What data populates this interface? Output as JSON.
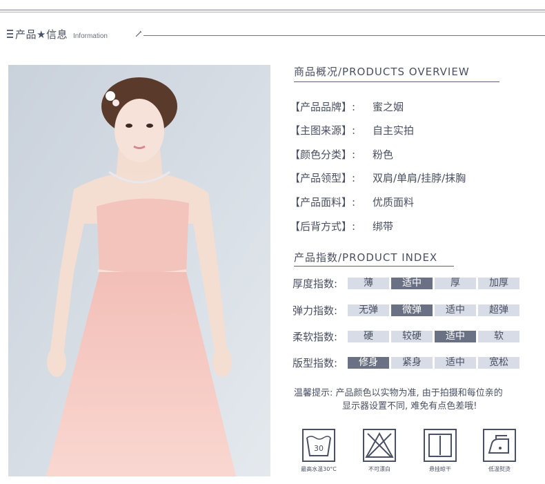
{
  "section_header": {
    "title": "产品★信息",
    "subtitle": "Information"
  },
  "overview": {
    "title": "商品概况/PRODUCTS OVERVIEW",
    "specs": [
      {
        "key": "【产品品牌】:",
        "value": "蜜之姻"
      },
      {
        "key": "【主图来源】:",
        "value": "自主实拍"
      },
      {
        "key": "【颜色分类】:",
        "value": "粉色"
      },
      {
        "key": "【产品领型】:",
        "value": "双肩/单肩/挂脖/抹胸"
      },
      {
        "key": "【产品面料】:",
        "value": "优质面料"
      },
      {
        "key": "【后背方式】:",
        "value": "绑带"
      }
    ]
  },
  "index": {
    "title": "产品指数/PRODUCT INDEX",
    "rows": [
      {
        "label": "厚度指数:",
        "options": [
          "薄",
          "适中",
          "厚",
          "加厚"
        ],
        "selected": 1
      },
      {
        "label": "弹力指数:",
        "options": [
          "无弹",
          "微弹",
          "适中",
          "超弹"
        ],
        "selected": 1
      },
      {
        "label": "柔软指数:",
        "options": [
          "硬",
          "较硬",
          "适中",
          "软"
        ],
        "selected": 2
      },
      {
        "label": "版型指数:",
        "options": [
          "修身",
          "紧身",
          "适中",
          "宽松"
        ],
        "selected": 0
      }
    ]
  },
  "notice": {
    "line1": "温馨提示: 产品颜色以实物为准, 由于拍摄和每位亲的",
    "line2": "显示器设置不同, 难免有点色差哦!"
  },
  "care": [
    {
      "icon": "wash-30-icon",
      "text": "30",
      "caption": "最高水温30°C"
    },
    {
      "icon": "no-bleach-icon",
      "caption": "不可漂白"
    },
    {
      "icon": "hang-dry-icon",
      "caption": "悬挂晾干"
    },
    {
      "icon": "low-iron-icon",
      "caption": "低温熨烫"
    }
  ],
  "colors": {
    "accent": "#6a7185",
    "cell_bg": "#d8dce6",
    "text": "#4a5063"
  }
}
